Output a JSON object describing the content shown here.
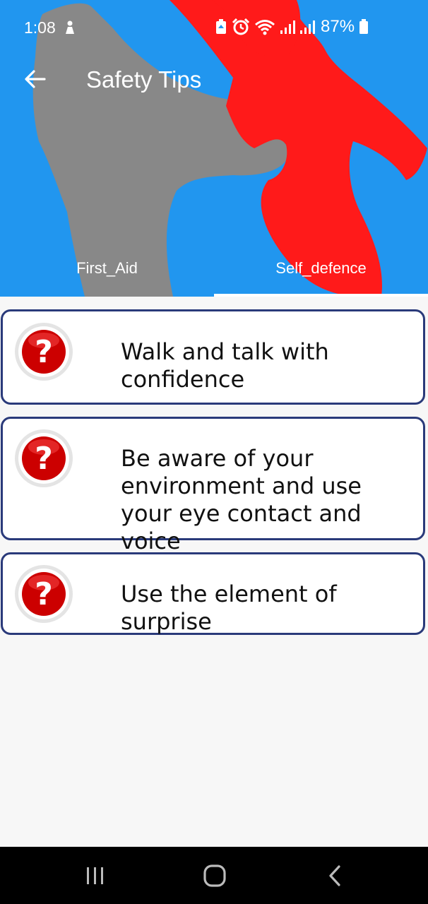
{
  "status_bar": {
    "time": "1:08",
    "battery_percent": "87%",
    "icons": [
      "person-notification-icon",
      "battery-saver-icon",
      "alarm-icon",
      "wifi-icon",
      "signal-icon",
      "signal-icon",
      "battery-icon"
    ]
  },
  "toolbar": {
    "back_icon": "arrow-left-icon",
    "title": "Safety Tips"
  },
  "tabs": [
    {
      "label": "First_Aid",
      "selected": false
    },
    {
      "label": "Self_defence",
      "selected": true
    }
  ],
  "tips": [
    {
      "icon": "question-mark-icon",
      "text": "Walk and talk with confidence"
    },
    {
      "icon": "question-mark-icon",
      "text": "Be aware of your environment and use your eye contact and voice"
    },
    {
      "icon": "question-mark-icon",
      "text": "Use the element of surprise"
    }
  ],
  "nav_bar": {
    "icons": [
      "recent-apps-icon",
      "home-icon",
      "back-icon"
    ]
  },
  "colors": {
    "header_bg": "#2196ef",
    "attacker_figure": "#ff1a1a",
    "victim_figure": "#888888",
    "card_border": "#2a3a7a",
    "icon_red": "#cc0000"
  }
}
